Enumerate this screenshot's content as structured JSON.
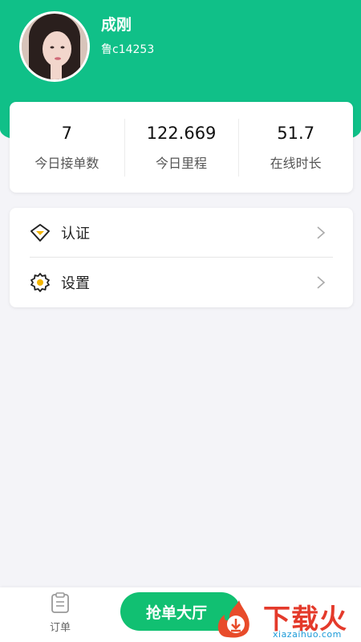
{
  "profile": {
    "name": "成刚",
    "id": "鲁c14253"
  },
  "stats": [
    {
      "value": "7",
      "label": "今日接单数"
    },
    {
      "value": "122.669",
      "label": "今日里程"
    },
    {
      "value": "51.7",
      "label": "在线时长"
    }
  ],
  "menu": [
    {
      "label": "认证",
      "icon": "diamond-badge-icon"
    },
    {
      "label": "设置",
      "icon": "gear-icon"
    }
  ],
  "bottom_nav": {
    "orders_label": "订单",
    "grab_label": "抢单大厅"
  },
  "watermark": {
    "text": "下载火",
    "sub": "xiazaihuo.com"
  },
  "colors": {
    "brand_green": "#10c088",
    "button_green": "#11c072",
    "background": "#f4f4f8",
    "watermark_red": "#e43a2b"
  }
}
